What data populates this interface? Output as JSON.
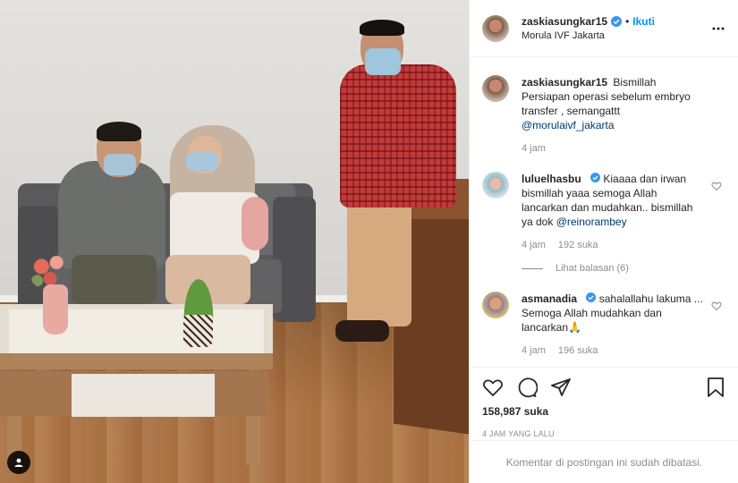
{
  "post": {
    "author": {
      "username": "zaskiasungkar15",
      "verified": true,
      "follow_label": "Ikuti",
      "location": "Morula IVF Jakarta"
    },
    "caption": {
      "username": "zaskiasungkar15",
      "text_line1": "Bismillah",
      "text_line2": "Persiapan operasi sebelum embryo",
      "text_line3": "transfer , semangattt",
      "mention": "@morulaivf_jakarta",
      "time": "4 jam"
    },
    "comments": [
      {
        "username": "luluelhasbu",
        "verified": true,
        "text": "Kiaaaa dan irwan bismillah yaaa semoga Allah lancarkan dan mudahkan.. bismillah ya dok",
        "mention": "@reinorambey",
        "time": "4 jam",
        "likes": "192 suka",
        "replies_label": "Lihat balasan (6)"
      },
      {
        "username": "asmanadia",
        "verified": true,
        "text": "sahalallahu lakuma ... Semoga Allah mudahkan dan lancarkan🙏",
        "time": "4 jam",
        "likes": "196 suka"
      }
    ],
    "likes_count": "158,987 suka",
    "posted_time": "4 JAM YANG LALU",
    "comments_disabled": "Komentar di postingan ini sudah dibatasi."
  },
  "icons": {
    "verified": "verified-badge-icon",
    "more": "more-options-icon",
    "like": "heart-icon",
    "comment": "comment-icon",
    "share": "send-icon",
    "save": "bookmark-icon",
    "tag": "user-tag-icon"
  },
  "colors": {
    "accent": "#0095f6",
    "verified": "#3897f0",
    "mention": "#00376b",
    "muted": "#8e8e8e",
    "text": "#262626"
  }
}
